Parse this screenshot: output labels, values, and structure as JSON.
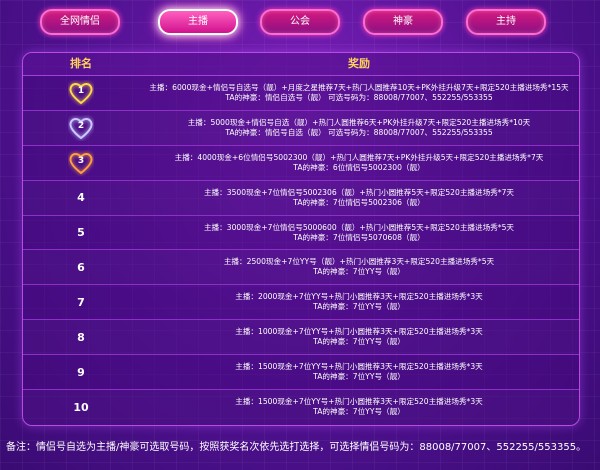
{
  "tabs": [
    {
      "label": "全网情侣",
      "active": false
    },
    {
      "label": "主播",
      "active": true
    },
    {
      "label": "公会",
      "active": false
    },
    {
      "label": "神豪",
      "active": false
    },
    {
      "label": "主持",
      "active": false
    }
  ],
  "table": {
    "rank_header": "排名",
    "reward_header": "奖励",
    "rows": [
      {
        "rank": "1",
        "badge": "heart",
        "badge_color": "#ffd84a",
        "lines": [
          "主播：6000现金+情侣号自选号（靓）+月度之星推荐7天+热门人圆推荐10天+PK外挂升级7天+限定520主播进场秀*15天",
          "TA的神豪：情侣自选号（靓） 可选号码为：88008/77007、552255/553355"
        ]
      },
      {
        "rank": "2",
        "badge": "heart",
        "badge_color": "#c9c9ff",
        "lines": [
          "主播：5000现金+情侣号自选（靓）+热门人圆推荐6天+PK外挂升级7天+限定520主播进场秀*10天",
          "TA的神豪：情侣号自选（靓） 可选号码为：88008/77007、552255/553355"
        ]
      },
      {
        "rank": "3",
        "badge": "heart",
        "badge_color": "#ff9f3f",
        "lines": [
          "主播：4000现金+6位情侣号5002300（靓）+热门人圆推荐7天+PK外挂升级5天+限定520主播进场秀*7天",
          "TA的神豪：6位情侣号5002300（靓）"
        ]
      },
      {
        "rank": "4",
        "badge": "",
        "badge_color": "",
        "lines": [
          "主播：3500现金+7位情侣号5002306（靓）+热门小圆推荐5天+限定520主播进场秀*7天",
          "TA的神豪：7位情侣号5002306（靓）"
        ]
      },
      {
        "rank": "5",
        "badge": "",
        "badge_color": "",
        "lines": [
          "主播：3000现金+7位情侣号5000600（靓）+热门小圆推荐5天+限定520主播进场秀*5天",
          "TA的神豪：7位情侣号5070608（靓）"
        ]
      },
      {
        "rank": "6",
        "badge": "",
        "badge_color": "",
        "lines": [
          "主播：2500现金+7位YY号（靓）+热门小圆推荐3天+限定520主播进场秀*5天",
          "TA的神豪：7位YY号（靓）"
        ]
      },
      {
        "rank": "7",
        "badge": "",
        "badge_color": "",
        "lines": [
          "主播：2000现金+7位YY号+热门小圆推荐3天+限定520主播进场秀*3天",
          "TA的神豪：7位YY号（靓）"
        ]
      },
      {
        "rank": "8",
        "badge": "",
        "badge_color": "",
        "lines": [
          "主播：1000现金+7位YY号+热门小圆推荐3天+限定520主播进场秀*3天",
          "TA的神豪：7位YY号（靓）"
        ]
      },
      {
        "rank": "9",
        "badge": "",
        "badge_color": "",
        "lines": [
          "主播：1500现金+7位YY号+热门小圆推荐3天+限定520主播进场秀*3天",
          "TA的神豪：7位YY号（靓）"
        ]
      },
      {
        "rank": "10",
        "badge": "",
        "badge_color": "",
        "lines": [
          "主播：1500现金+7位YY号+热门小圆推荐3天+限定520主播进场秀*3天",
          "TA的神豪：7位YY号（靓）"
        ]
      }
    ]
  },
  "footer": {
    "note": "备注：情侣号自选为主播/神豪可选取号码，按照获奖名次依先选打选择，可选择情侣号码为：88008/77007、552255/553355。"
  },
  "colors": {
    "accent_pink": "#ff4fc8",
    "header_gold": "#ffd35a",
    "border_purple": "#b84be0"
  }
}
